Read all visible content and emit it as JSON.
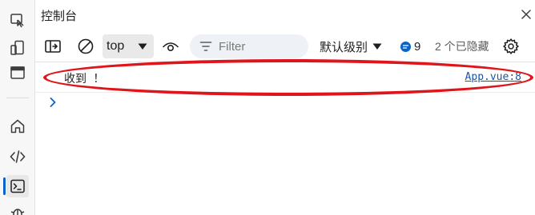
{
  "panel": {
    "title": "控制台"
  },
  "sidebar": {
    "items": [
      {
        "icon": "inspect-element-icon"
      },
      {
        "icon": "device-emulation-icon"
      },
      {
        "icon": "dock-panel-icon"
      },
      {
        "icon": "home-icon"
      },
      {
        "icon": "elements-code-icon"
      },
      {
        "icon": "console-icon",
        "active": true
      },
      {
        "icon": "debugger-bug-icon"
      }
    ]
  },
  "toolbar": {
    "context_value": "top",
    "filter_placeholder": "Filter",
    "level_label": "默认级别",
    "issues_count": "9",
    "hidden_label": "2 个已隐藏"
  },
  "console": {
    "messages": [
      {
        "text": "收到 ！",
        "source": "App.vue:8"
      }
    ]
  },
  "colors": {
    "accent": "#0a63c9",
    "highlight": "#e0151b",
    "link": "#1a55a8"
  }
}
